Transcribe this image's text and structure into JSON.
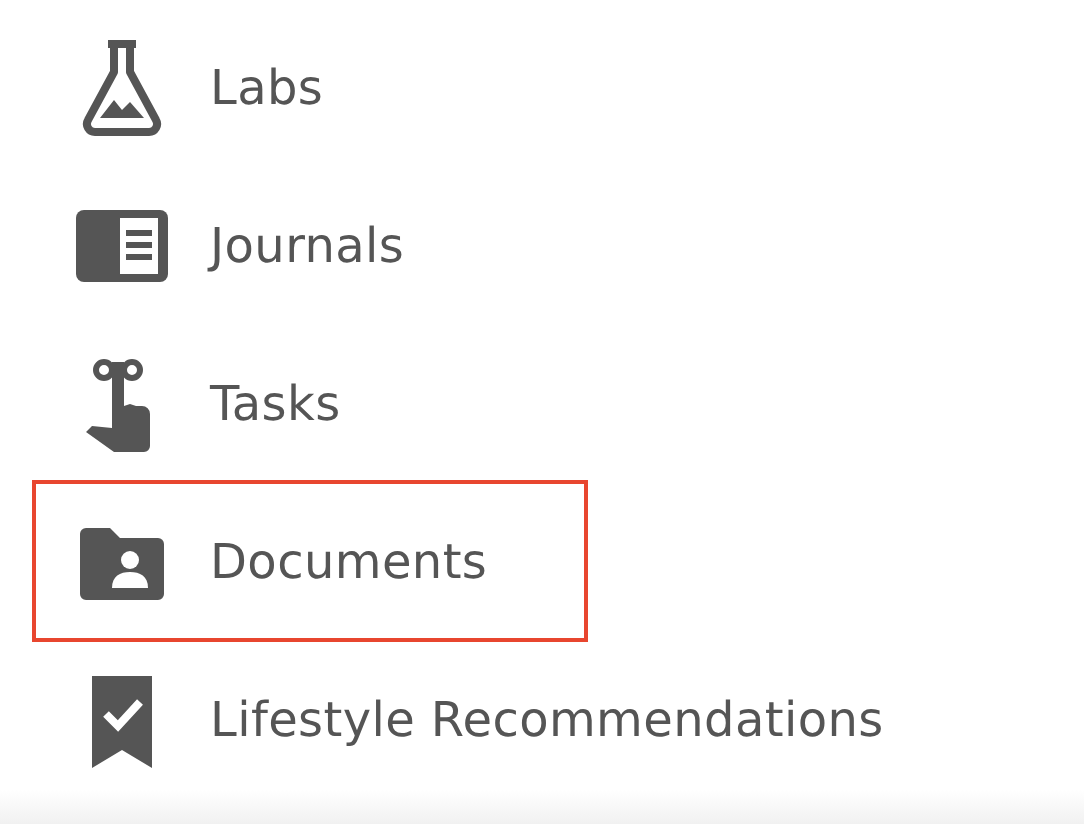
{
  "menu": {
    "items": [
      {
        "label": "Labs",
        "selected": false
      },
      {
        "label": "Journals",
        "selected": false
      },
      {
        "label": "Tasks",
        "selected": false
      },
      {
        "label": "Documents",
        "selected": true
      },
      {
        "label": "Lifestyle Recommendations",
        "selected": false
      }
    ]
  }
}
